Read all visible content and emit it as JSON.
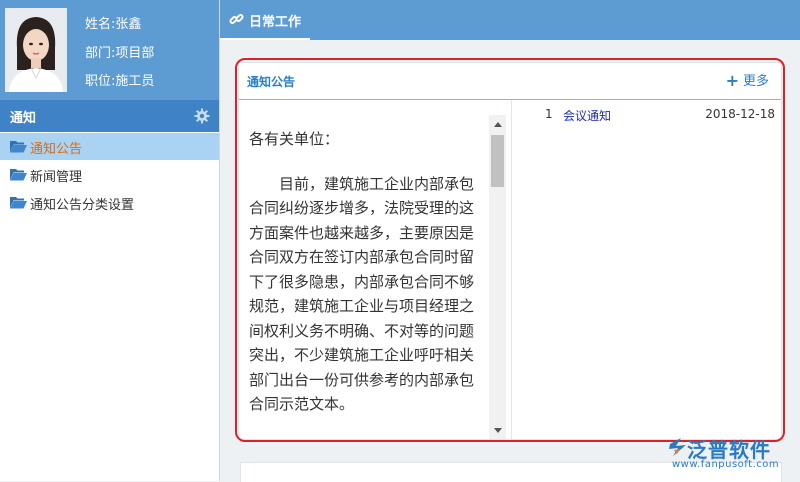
{
  "profile": {
    "name_line": "姓名:张鑫",
    "dept_line": "部门:项目部",
    "role_line": "职位:施工员"
  },
  "sidebar": {
    "section_title": "通知",
    "items": [
      {
        "label": "通知公告",
        "active": true
      },
      {
        "label": "新闻管理",
        "active": false
      },
      {
        "label": "通知公告分类设置",
        "active": false
      }
    ]
  },
  "topbar": {
    "tab_label": "日常工作"
  },
  "panel": {
    "title": "通知公告",
    "more_label": "更多",
    "greeting": "各有关单位：",
    "body": "目前，建筑施工企业内部承包合同纠纷逐步增多，法院受理的这方面案件也越来越多，主要原因是合同双方在签订内部承包合同时留下了很多隐患，内部承包合同不够规范，建筑施工企业与项目经理之间权利义务不明确、不对等的问题突出，不少建筑施工企业呼吁相关部门出台一份可供参考的内部承包合同示范文本。",
    "list": [
      {
        "num": "1",
        "title": "会议通知",
        "date": "2018-12-18"
      }
    ]
  },
  "watermark": {
    "name": "泛普软件",
    "url": "www.fanpusoft.com"
  },
  "colors": {
    "header_blue": "#5d9bd3",
    "section_blue": "#3f82c6",
    "active_bg": "#a9d2f3",
    "active_text": "#e06a0c",
    "link_blue": "#2a7fc9",
    "highlight_red": "#d9232a"
  }
}
